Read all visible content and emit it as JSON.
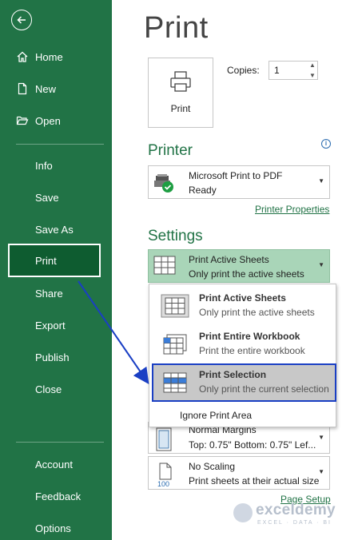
{
  "sidebar": {
    "items": [
      {
        "label": "Home"
      },
      {
        "label": "New"
      },
      {
        "label": "Open"
      },
      {
        "label": "Info"
      },
      {
        "label": "Save"
      },
      {
        "label": "Save As"
      },
      {
        "label": "Print"
      },
      {
        "label": "Share"
      },
      {
        "label": "Export"
      },
      {
        "label": "Publish"
      },
      {
        "label": "Close"
      },
      {
        "label": "Account"
      },
      {
        "label": "Feedback"
      },
      {
        "label": "Options"
      }
    ],
    "active": "Print"
  },
  "main": {
    "title": "Print",
    "print_button_label": "Print",
    "copies_label": "Copies:",
    "copies_value": "1",
    "printer_heading": "Printer",
    "printer": {
      "name": "Microsoft Print to PDF",
      "status": "Ready"
    },
    "printer_properties_link": "Printer Properties",
    "settings_heading": "Settings",
    "what_to_print": {
      "title": "Print Active Sheets",
      "desc": "Only print the active sheets"
    },
    "menu": {
      "items": [
        {
          "title": "Print Active Sheets",
          "desc": "Only print the active sheets"
        },
        {
          "title": "Print Entire Workbook",
          "desc": "Print the entire workbook"
        },
        {
          "title": "Print Selection",
          "desc": "Only print the current selection"
        }
      ],
      "selected": "Print Selection",
      "ignore_print_area": "Ignore Print Area"
    },
    "margins": {
      "title": "Normal Margins",
      "desc": "Top: 0.75\" Bottom: 0.75\" Lef..."
    },
    "scaling": {
      "title": "No Scaling",
      "desc": "Print sheets at their actual size",
      "icon_text": "100"
    },
    "page_setup_link": "Page Setup"
  },
  "watermark": {
    "name": "exceldemy",
    "tagline": "EXCEL · DATA · BI"
  },
  "colors": {
    "sidebar": "#217346",
    "accent_green": "#217346",
    "highlight_blue": "#1a3fc4",
    "selected_dropdown": "#a9d5b8"
  }
}
